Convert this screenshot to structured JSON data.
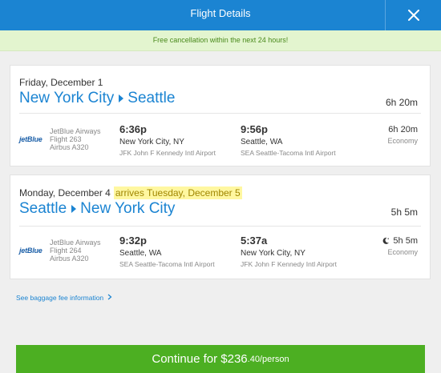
{
  "header": {
    "title": "Flight Details"
  },
  "banner": {
    "text": "Free cancellation within the next 24 hours!"
  },
  "flights": [
    {
      "date": "Friday, December 1",
      "arrives_note": "",
      "origin": "New York City",
      "destination": "Seattle",
      "duration": "6h 20m",
      "airline_logo": "jetBlue",
      "airline": "JetBlue Airways",
      "flight": "Flight 263",
      "aircraft": "Airbus A320",
      "depart_time": "6:36p",
      "depart_city": "New York City, NY",
      "depart_airport": "JFK John F Kennedy Intl Airport",
      "arrive_time": "9:56p",
      "arrive_city": "Seattle, WA",
      "arrive_airport": "SEA Seattle-Tacoma Intl Airport",
      "segment_duration": "6h 20m",
      "cabin": "Economy"
    },
    {
      "date": "Monday, December 4",
      "arrives_note": "arrives Tuesday, December 5",
      "origin": "Seattle",
      "destination": "New York City",
      "duration": "5h 5m",
      "airline_logo": "jetBlue",
      "airline": "JetBlue Airways",
      "flight": "Flight 264",
      "aircraft": "Airbus A320",
      "depart_time": "9:32p",
      "depart_city": "Seattle, WA",
      "depart_airport": "SEA Seattle-Tacoma Intl Airport",
      "arrive_time": "5:37a",
      "arrive_city": "New York City, NY",
      "arrive_airport": "JFK John F Kennedy Intl Airport",
      "segment_duration": "5h 5m",
      "cabin": "Economy",
      "overnight_icon": "moon-icon"
    }
  ],
  "baggage_link": "See baggage fee information",
  "continue": {
    "label": "Continue for $236",
    "cents": ".40/person"
  },
  "colors": {
    "header": "#1b84d2",
    "banner": "#e3f5cf",
    "continue": "#4caf22",
    "link": "#1b84d2",
    "highlight": "#fff7a0"
  }
}
